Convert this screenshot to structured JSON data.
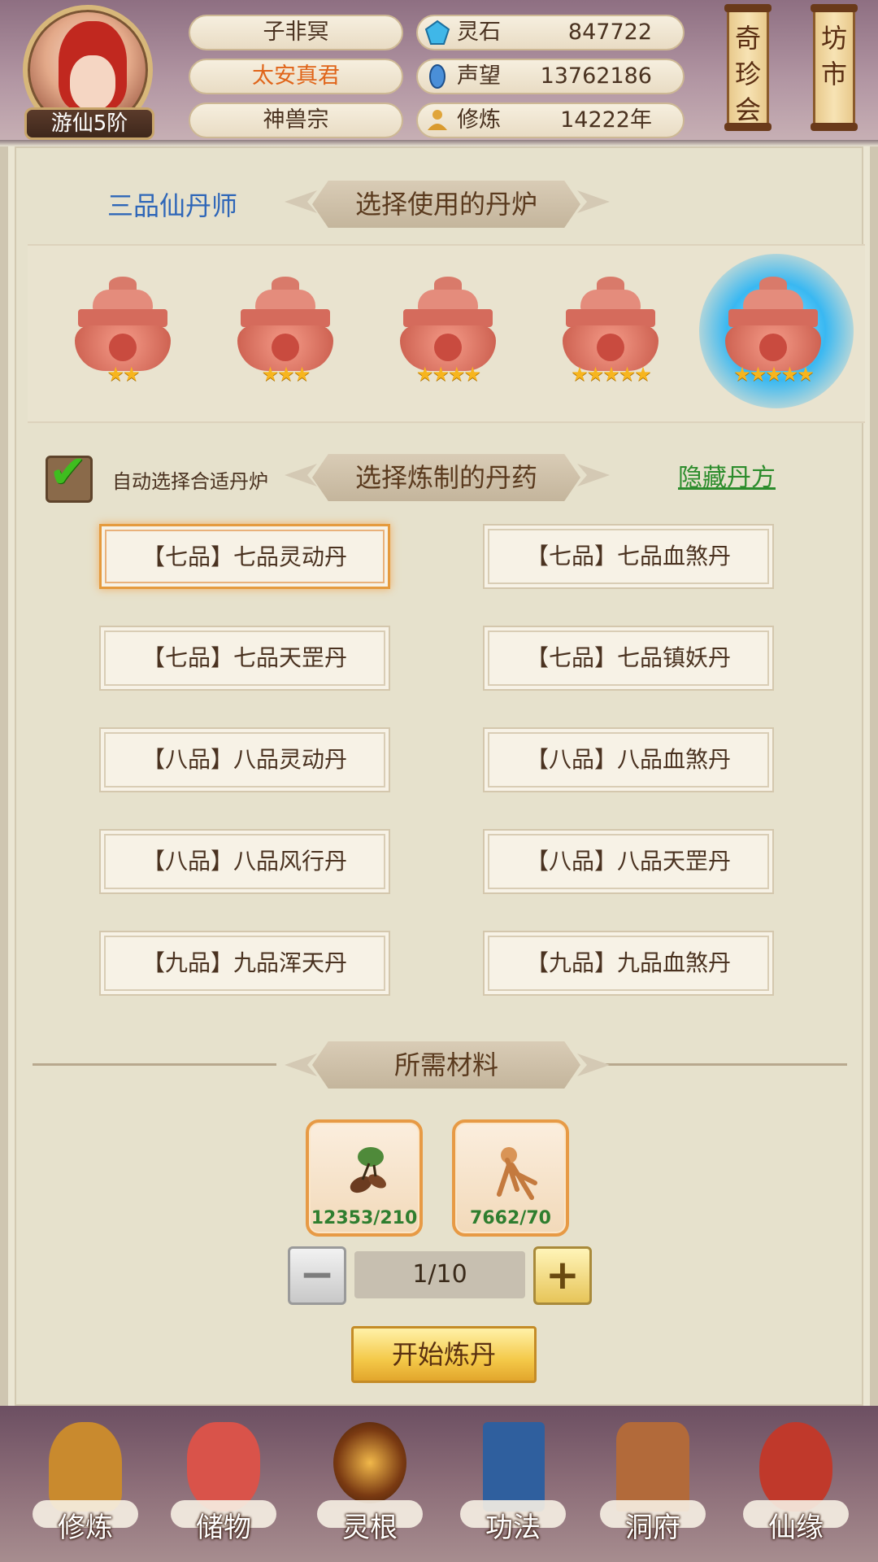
{
  "header": {
    "player_name": "子非冥",
    "player_title": "太安真君",
    "sect": "神兽宗",
    "rank_badge": "游仙5阶",
    "resources": [
      {
        "icon": "spirit-stone-icon",
        "name": "灵石",
        "value": "847722"
      },
      {
        "icon": "reputation-icon",
        "name": "声望",
        "value": "13762186"
      },
      {
        "icon": "meditation-icon",
        "name": "修炼",
        "value": "14222年"
      }
    ],
    "shop_buttons": [
      "奇珍会",
      "坊市"
    ]
  },
  "alchemist_rank": "三品仙丹师",
  "furnace_section": {
    "title": "选择使用的丹炉",
    "furnaces": [
      {
        "stars": "★★",
        "selected": false
      },
      {
        "stars": "★★★",
        "selected": false
      },
      {
        "stars": "★★★★",
        "selected": false
      },
      {
        "stars": "★★★★★",
        "selected": false
      },
      {
        "stars": "★★★★★",
        "selected": true
      }
    ]
  },
  "pill_section": {
    "title": "选择炼制的丹药",
    "auto_select_label": "自动选择合适丹炉",
    "auto_select_checked": true,
    "hide_recipe_link": "隐藏丹方",
    "pills": [
      {
        "label": "【七品】七品灵动丹",
        "selected": true
      },
      {
        "label": "【七品】七品血煞丹",
        "selected": false
      },
      {
        "label": "【七品】七品天罡丹",
        "selected": false
      },
      {
        "label": "【七品】七品镇妖丹",
        "selected": false
      },
      {
        "label": "【八品】八品灵动丹",
        "selected": false
      },
      {
        "label": "【八品】八品血煞丹",
        "selected": false
      },
      {
        "label": "【八品】八品风行丹",
        "selected": false
      },
      {
        "label": "【八品】八品天罡丹",
        "selected": false
      },
      {
        "label": "【九品】九品浑天丹",
        "selected": false
      },
      {
        "label": "【九品】九品血煞丹",
        "selected": false
      }
    ]
  },
  "materials_section": {
    "title": "所需材料",
    "materials": [
      {
        "icon": "herb-root-icon",
        "count": "12353/210"
      },
      {
        "icon": "ginseng-icon",
        "count": "7662/70"
      }
    ],
    "quantity": "1/10",
    "minus_label": "−",
    "plus_label": "+",
    "start_button": "开始炼丹"
  },
  "bottom_nav": [
    {
      "icon": "cultivate-icon",
      "label": "修炼",
      "color": "#c98a2e"
    },
    {
      "icon": "storage-bag-icon",
      "label": "储物",
      "color": "#d9534a"
    },
    {
      "icon": "spirit-root-icon",
      "label": "灵根",
      "color": "#7a3a12"
    },
    {
      "icon": "technique-book-icon",
      "label": "功法",
      "color": "#2f5f9e"
    },
    {
      "icon": "cave-abode-icon",
      "label": "洞府",
      "color": "#b26a3a"
    },
    {
      "icon": "gourd-icon",
      "label": "仙缘",
      "color": "#c0392b"
    }
  ]
}
